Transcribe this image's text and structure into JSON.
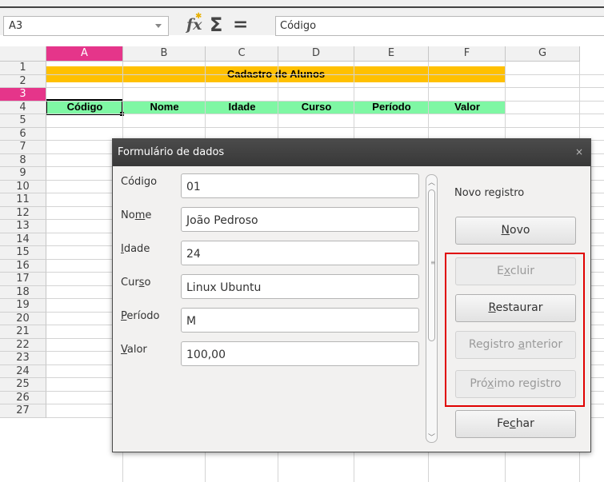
{
  "formula_bar": {
    "name_box": "A3",
    "formula": "Código"
  },
  "columns": [
    "A",
    "B",
    "C",
    "D",
    "E",
    "F",
    "G"
  ],
  "rows": [
    "1",
    "2",
    "3",
    "4",
    "5",
    "6",
    "7",
    "8",
    "9",
    "10",
    "11",
    "12",
    "13",
    "14",
    "15",
    "16",
    "17",
    "18",
    "19",
    "20",
    "21",
    "22",
    "23",
    "24",
    "25",
    "26",
    "27"
  ],
  "selected_column": "A",
  "selected_row": "3",
  "sheet": {
    "title": "Cadastro de Alunos",
    "headers": [
      "Código",
      "Nome",
      "Idade",
      "Curso",
      "Período",
      "Valor"
    ]
  },
  "dialog": {
    "title": "Formulário de dados",
    "close": "×",
    "fields": [
      {
        "label_pre": "Código",
        "label_u": "",
        "label_post": "",
        "value": "01"
      },
      {
        "label_pre": "No",
        "label_u": "m",
        "label_post": "e",
        "value": "João Pedroso"
      },
      {
        "label_pre": "",
        "label_u": "I",
        "label_post": "dade",
        "value": "24"
      },
      {
        "label_pre": "Cur",
        "label_u": "s",
        "label_post": "o",
        "value": "Linux Ubuntu"
      },
      {
        "label_pre": "",
        "label_u": "P",
        "label_post": "eríodo",
        "value": "M"
      },
      {
        "label_pre": "",
        "label_u": "V",
        "label_post": "alor",
        "value": "100,00"
      }
    ],
    "record_status": "Novo registro",
    "buttons": {
      "novo": {
        "pre": "",
        "u": "N",
        "post": "ovo"
      },
      "excluir": {
        "pre": "E",
        "u": "x",
        "post": "cluir"
      },
      "restaurar": {
        "pre": "",
        "u": "R",
        "post": "estaurar"
      },
      "anterior": {
        "pre": "Registro ",
        "u": "a",
        "post": "nterior"
      },
      "proximo": {
        "pre": "Pró",
        "u": "x",
        "post": "imo registro"
      },
      "fechar": {
        "pre": "Fe",
        "u": "c",
        "post": "har"
      }
    }
  },
  "colors": {
    "title_fill": "#ffc000",
    "header_fill": "#7ff7a4",
    "selection": "#e5358a",
    "highlight": "#e00000"
  }
}
